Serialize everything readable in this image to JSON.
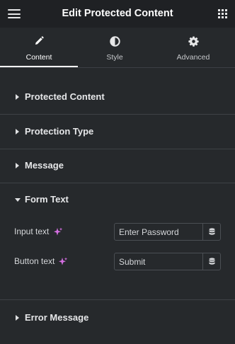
{
  "header": {
    "title": "Edit Protected Content",
    "menu_icon": "hamburger-icon",
    "apps_icon": "grid-icon"
  },
  "tabs": [
    {
      "label": "Content",
      "icon": "pencil-icon",
      "active": true
    },
    {
      "label": "Style",
      "icon": "half-circle-icon",
      "active": false
    },
    {
      "label": "Advanced",
      "icon": "gear-icon",
      "active": false
    }
  ],
  "sections": {
    "protected_content": "Protected Content",
    "protection_type": "Protection Type",
    "message": "Message",
    "form_text": "Form Text",
    "error_message": "Error Message"
  },
  "form_text": {
    "input_label": "Input text",
    "input_value": "Enter Password",
    "button_label": "Button text",
    "button_value": "Submit"
  },
  "colors": {
    "background": "#26292c",
    "header": "#1f2124",
    "ai_accent": "#d36ee0"
  }
}
